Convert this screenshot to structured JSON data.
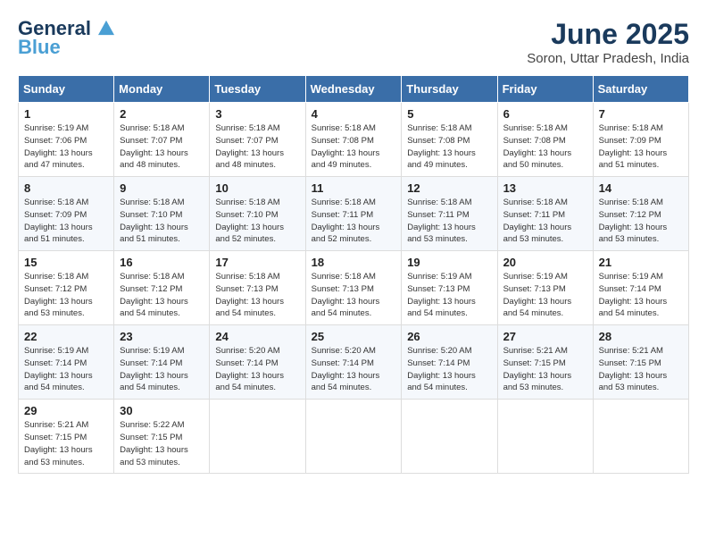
{
  "header": {
    "logo_line1": "General",
    "logo_line2": "Blue",
    "month": "June 2025",
    "location": "Soron, Uttar Pradesh, India"
  },
  "weekdays": [
    "Sunday",
    "Monday",
    "Tuesday",
    "Wednesday",
    "Thursday",
    "Friday",
    "Saturday"
  ],
  "weeks": [
    [
      {
        "day": "1",
        "sunrise": "5:19 AM",
        "sunset": "7:06 PM",
        "daylight": "13 hours and 47 minutes."
      },
      {
        "day": "2",
        "sunrise": "5:18 AM",
        "sunset": "7:07 PM",
        "daylight": "13 hours and 48 minutes."
      },
      {
        "day": "3",
        "sunrise": "5:18 AM",
        "sunset": "7:07 PM",
        "daylight": "13 hours and 48 minutes."
      },
      {
        "day": "4",
        "sunrise": "5:18 AM",
        "sunset": "7:08 PM",
        "daylight": "13 hours and 49 minutes."
      },
      {
        "day": "5",
        "sunrise": "5:18 AM",
        "sunset": "7:08 PM",
        "daylight": "13 hours and 49 minutes."
      },
      {
        "day": "6",
        "sunrise": "5:18 AM",
        "sunset": "7:08 PM",
        "daylight": "13 hours and 50 minutes."
      },
      {
        "day": "7",
        "sunrise": "5:18 AM",
        "sunset": "7:09 PM",
        "daylight": "13 hours and 51 minutes."
      }
    ],
    [
      {
        "day": "8",
        "sunrise": "5:18 AM",
        "sunset": "7:09 PM",
        "daylight": "13 hours and 51 minutes."
      },
      {
        "day": "9",
        "sunrise": "5:18 AM",
        "sunset": "7:10 PM",
        "daylight": "13 hours and 51 minutes."
      },
      {
        "day": "10",
        "sunrise": "5:18 AM",
        "sunset": "7:10 PM",
        "daylight": "13 hours and 52 minutes."
      },
      {
        "day": "11",
        "sunrise": "5:18 AM",
        "sunset": "7:11 PM",
        "daylight": "13 hours and 52 minutes."
      },
      {
        "day": "12",
        "sunrise": "5:18 AM",
        "sunset": "7:11 PM",
        "daylight": "13 hours and 53 minutes."
      },
      {
        "day": "13",
        "sunrise": "5:18 AM",
        "sunset": "7:11 PM",
        "daylight": "13 hours and 53 minutes."
      },
      {
        "day": "14",
        "sunrise": "5:18 AM",
        "sunset": "7:12 PM",
        "daylight": "13 hours and 53 minutes."
      }
    ],
    [
      {
        "day": "15",
        "sunrise": "5:18 AM",
        "sunset": "7:12 PM",
        "daylight": "13 hours and 53 minutes."
      },
      {
        "day": "16",
        "sunrise": "5:18 AM",
        "sunset": "7:12 PM",
        "daylight": "13 hours and 54 minutes."
      },
      {
        "day": "17",
        "sunrise": "5:18 AM",
        "sunset": "7:13 PM",
        "daylight": "13 hours and 54 minutes."
      },
      {
        "day": "18",
        "sunrise": "5:18 AM",
        "sunset": "7:13 PM",
        "daylight": "13 hours and 54 minutes."
      },
      {
        "day": "19",
        "sunrise": "5:19 AM",
        "sunset": "7:13 PM",
        "daylight": "13 hours and 54 minutes."
      },
      {
        "day": "20",
        "sunrise": "5:19 AM",
        "sunset": "7:13 PM",
        "daylight": "13 hours and 54 minutes."
      },
      {
        "day": "21",
        "sunrise": "5:19 AM",
        "sunset": "7:14 PM",
        "daylight": "13 hours and 54 minutes."
      }
    ],
    [
      {
        "day": "22",
        "sunrise": "5:19 AM",
        "sunset": "7:14 PM",
        "daylight": "13 hours and 54 minutes."
      },
      {
        "day": "23",
        "sunrise": "5:19 AM",
        "sunset": "7:14 PM",
        "daylight": "13 hours and 54 minutes."
      },
      {
        "day": "24",
        "sunrise": "5:20 AM",
        "sunset": "7:14 PM",
        "daylight": "13 hours and 54 minutes."
      },
      {
        "day": "25",
        "sunrise": "5:20 AM",
        "sunset": "7:14 PM",
        "daylight": "13 hours and 54 minutes."
      },
      {
        "day": "26",
        "sunrise": "5:20 AM",
        "sunset": "7:14 PM",
        "daylight": "13 hours and 54 minutes."
      },
      {
        "day": "27",
        "sunrise": "5:21 AM",
        "sunset": "7:15 PM",
        "daylight": "13 hours and 53 minutes."
      },
      {
        "day": "28",
        "sunrise": "5:21 AM",
        "sunset": "7:15 PM",
        "daylight": "13 hours and 53 minutes."
      }
    ],
    [
      {
        "day": "29",
        "sunrise": "5:21 AM",
        "sunset": "7:15 PM",
        "daylight": "13 hours and 53 minutes."
      },
      {
        "day": "30",
        "sunrise": "5:22 AM",
        "sunset": "7:15 PM",
        "daylight": "13 hours and 53 minutes."
      },
      null,
      null,
      null,
      null,
      null
    ]
  ]
}
